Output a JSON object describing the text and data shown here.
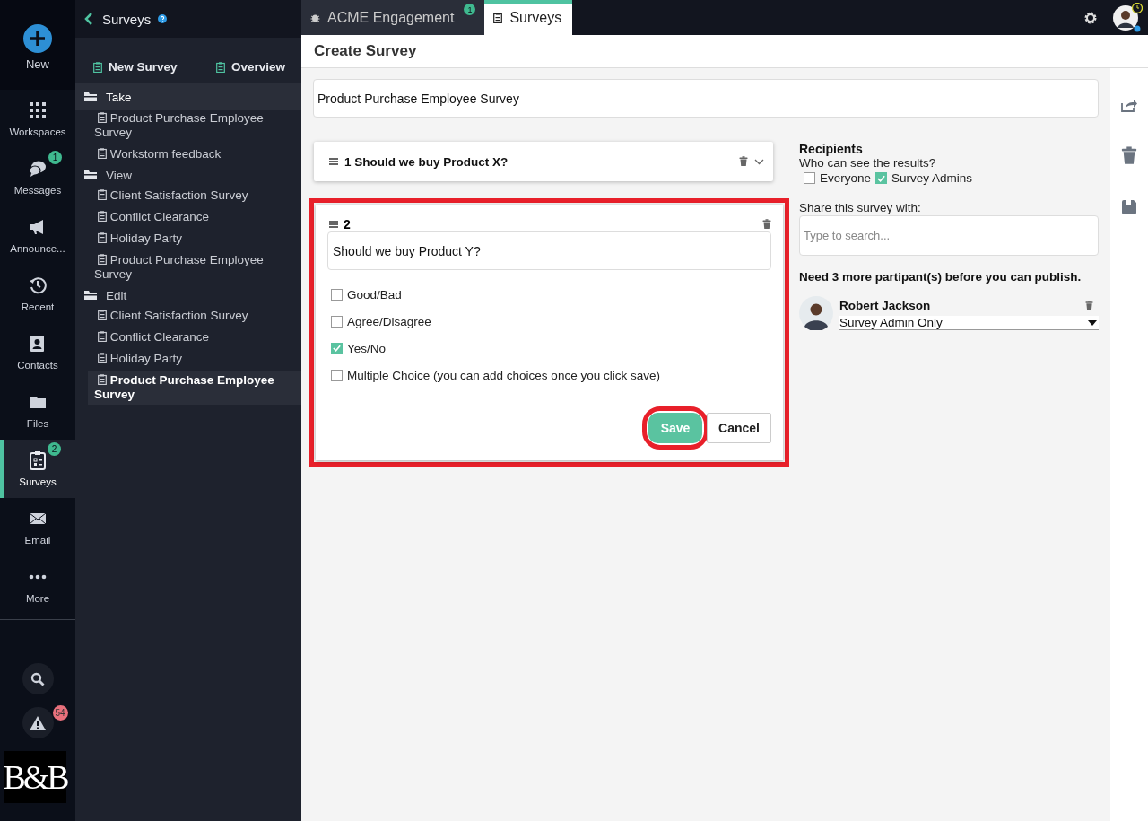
{
  "rail": {
    "new_label": "New",
    "items": [
      {
        "label": "Workspaces",
        "selected": false
      },
      {
        "label": "Messages",
        "badge": "1",
        "selected": false
      },
      {
        "label": "Announce...",
        "selected": false
      },
      {
        "label": "Recent",
        "selected": false
      },
      {
        "label": "Contacts",
        "selected": false
      },
      {
        "label": "Files",
        "selected": false
      },
      {
        "label": "Surveys",
        "badge": "2",
        "selected": true
      },
      {
        "label": "Email",
        "selected": false
      },
      {
        "label": "More",
        "selected": false
      }
    ],
    "alerts_badge": "54",
    "logo": "B&B"
  },
  "sidebar": {
    "title": "Surveys",
    "actions": [
      "New Survey",
      "Overview"
    ],
    "groups": [
      {
        "label": "Take",
        "selected": true,
        "children": [
          {
            "label": "Product Purchase Employee Survey",
            "selected": false
          },
          {
            "label": "Workstorm feedback",
            "selected": false
          }
        ]
      },
      {
        "label": "View",
        "selected": false,
        "children": [
          {
            "label": "Client Satisfaction Survey",
            "selected": false
          },
          {
            "label": "Conflict Clearance",
            "selected": false
          },
          {
            "label": "Holiday Party",
            "selected": false
          },
          {
            "label": "Product Purchase Employee Survey",
            "selected": false
          }
        ]
      },
      {
        "label": "Edit",
        "selected": false,
        "children": [
          {
            "label": "Client Satisfaction Survey",
            "selected": false
          },
          {
            "label": "Conflict Clearance",
            "selected": false
          },
          {
            "label": "Holiday Party",
            "selected": false
          },
          {
            "label": "Product Purchase Employee Survey",
            "selected": true
          }
        ]
      }
    ]
  },
  "tabs": [
    {
      "label": "ACME Engagement",
      "badge": "1",
      "selected": false
    },
    {
      "label": "Surveys",
      "selected": true
    }
  ],
  "page": {
    "title": "Create Survey",
    "survey_name": "Product Purchase Employee Survey",
    "questions": [
      {
        "kind": "collapsed",
        "title": "1 Should we buy Product X?",
        "highlighted": false
      },
      {
        "kind": "editor",
        "number": "2",
        "text": "Should we buy Product Y?",
        "highlighted": true,
        "options": [
          {
            "label": "Good/Bad",
            "checked": false
          },
          {
            "label": "Agree/Disagree",
            "checked": false
          },
          {
            "label": "Yes/No",
            "checked": true
          },
          {
            "label": "Multiple Choice (you can add choices once you click save)",
            "checked": false
          }
        ],
        "save": {
          "label": "Save",
          "highlighted": true
        },
        "cancel": "Cancel"
      }
    ]
  },
  "recipients": {
    "title": "Recipients",
    "question": "Who can see the results?",
    "audiences": [
      {
        "label": "Everyone",
        "checked": false
      },
      {
        "label": "Survey Admins",
        "checked": true
      }
    ],
    "share_label": "Share this survey with:",
    "search_placeholder": "Type to search...",
    "notice": "Need 3 more partipant(s) before you can publish.",
    "participants": [
      {
        "name": "Robert Jackson",
        "role": "Survey Admin Only"
      }
    ]
  }
}
